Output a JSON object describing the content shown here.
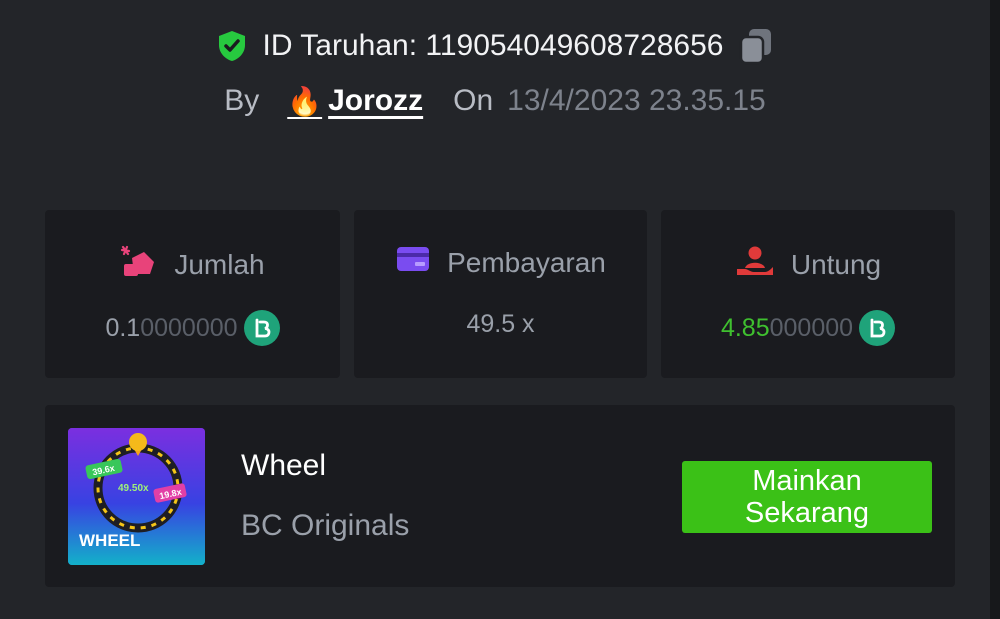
{
  "header": {
    "bet_id_text": "ID Taruhan: 1190540496087 28656",
    "by_label": "By",
    "user_emoji": "🔥",
    "username": "Jorozz",
    "on_label": "On",
    "datetime": "13/4/2023 23.35.15"
  },
  "stats": {
    "amount": {
      "label": "Jumlah",
      "value_main": "0.1",
      "value_dim": "0000000",
      "icon": "bet-amount-icon"
    },
    "payout": {
      "label": "Pembayaran",
      "value": "49.5 x",
      "icon": "card-icon"
    },
    "profit": {
      "label": "Untung",
      "value_main": "4.85",
      "value_dim": "000000",
      "icon": "profit-hand-icon"
    }
  },
  "game": {
    "title": "Wheel",
    "provider": "BC Originals",
    "thumbnail_label": "WHEEL",
    "thumb_tags": [
      "39.6x",
      "49.50x",
      "19.8x"
    ],
    "play_button": "Mainkan Sekarang"
  },
  "colors": {
    "background": "#232529",
    "card": "#1a1b1f",
    "accent_green": "#3bc117",
    "profit_green": "#3fc02f",
    "coin": "#1fa37a"
  }
}
